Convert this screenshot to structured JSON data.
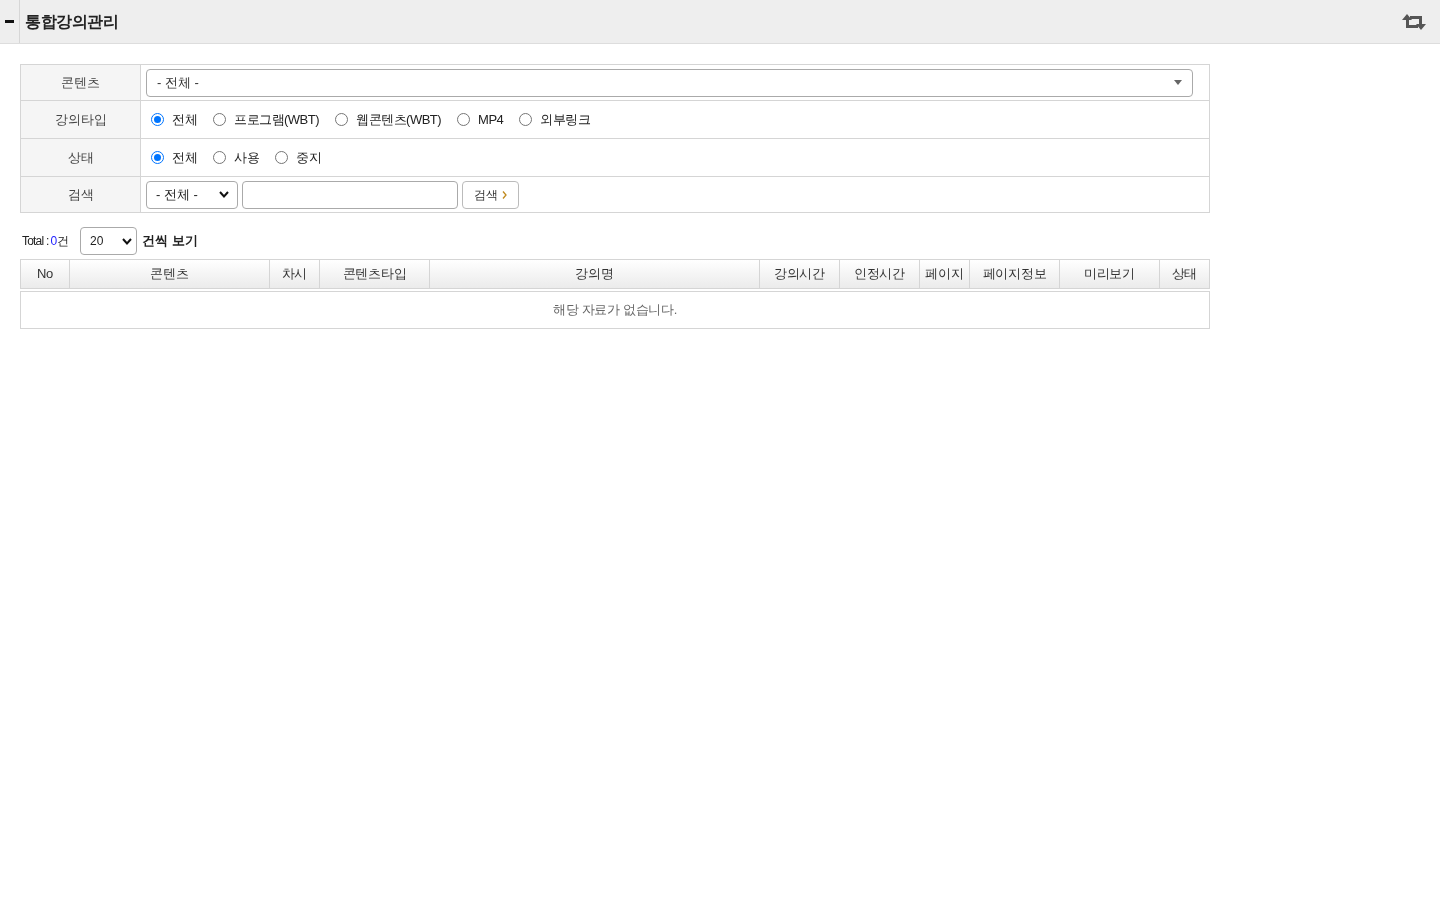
{
  "header": {
    "title": "통합강의관리"
  },
  "filters": [
    {
      "kind": "select",
      "label": "콘텐츠",
      "value": "- 전체 -"
    },
    {
      "kind": "radio",
      "label": "강의타입",
      "options": [
        {
          "label": "전체",
          "selected": true
        },
        {
          "label": "프로그램(WBT)",
          "selected": false
        },
        {
          "label": "웹콘텐츠(WBT)",
          "selected": false
        },
        {
          "label": "MP4",
          "selected": false
        },
        {
          "label": "외부링크",
          "selected": false
        }
      ]
    },
    {
      "kind": "radio",
      "label": "상태",
      "options": [
        {
          "label": "전체",
          "selected": true
        },
        {
          "label": "사용",
          "selected": false
        },
        {
          "label": "중지",
          "selected": false
        }
      ]
    },
    {
      "kind": "search",
      "label": "검색",
      "select_value": "- 전체 -",
      "button": "검색"
    }
  ],
  "list_summary": {
    "total_label": "Total :",
    "count": "0",
    "count_unit": "건",
    "page_size": "20",
    "page_size_suffix": "건씩 보기"
  },
  "table": {
    "columns": [
      "No",
      "콘텐츠",
      "차시",
      "콘텐츠타입",
      "강의명",
      "강의시간",
      "인정시간",
      "페이지",
      "페이지정보",
      "미리보기",
      "상태"
    ],
    "empty_message": "해당 자료가 없습니다."
  }
}
